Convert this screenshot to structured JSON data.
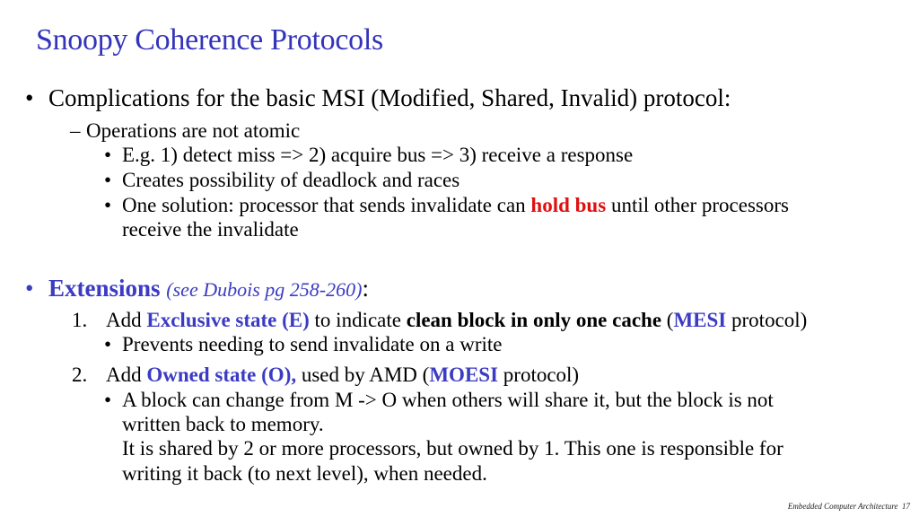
{
  "slide": {
    "title": "Snoopy Coherence Protocols",
    "footer": {
      "course": "Embedded Computer Architecture",
      "page": "17"
    },
    "complications": {
      "bullet": "•",
      "heading": "Complications for the basic MSI (Modified, Shared, Invalid) protocol:",
      "sub_marker": "–",
      "sub": "Operations are not atomic",
      "items": [
        "E.g. 1) detect miss => 2) acquire bus => 3) receive a response",
        "Creates possibility of deadlock and races"
      ],
      "solution": {
        "before": "One solution:  processor that sends invalidate can ",
        "highlight": "hold bus",
        "after": " until other processors",
        "cont": "receive the invalidate"
      }
    },
    "extensions": {
      "bullet": "•",
      "heading": "Extensions",
      "ref": "(see Dubois pg 258-260)",
      "colon": ":",
      "item1": {
        "num": "1.",
        "add": "Add ",
        "state": "Exclusive state (E)",
        "mid": " to indicate ",
        "bold": "clean block in only one cache",
        "open": " (",
        "proto": "MESI",
        "close": " protocol)",
        "sub": "Prevents needing to send invalidate on a write"
      },
      "item2": {
        "num": "2.",
        "add": "Add ",
        "state": "Owned state (O),",
        "mid": " used by AMD (",
        "proto": "MOESI",
        "close": " protocol)",
        "sub_lines": [
          "A block can change from M -> O when others will share it, but the block is not",
          "written back to memory.",
          "It is shared by 2 or more processors, but owned by 1. This one is responsible for",
          "writing it back (to next level), when needed."
        ]
      }
    }
  },
  "colors": {
    "title": "#3333bb",
    "accent_blue": "#3b3bc4",
    "accent_red": "#e01010"
  }
}
